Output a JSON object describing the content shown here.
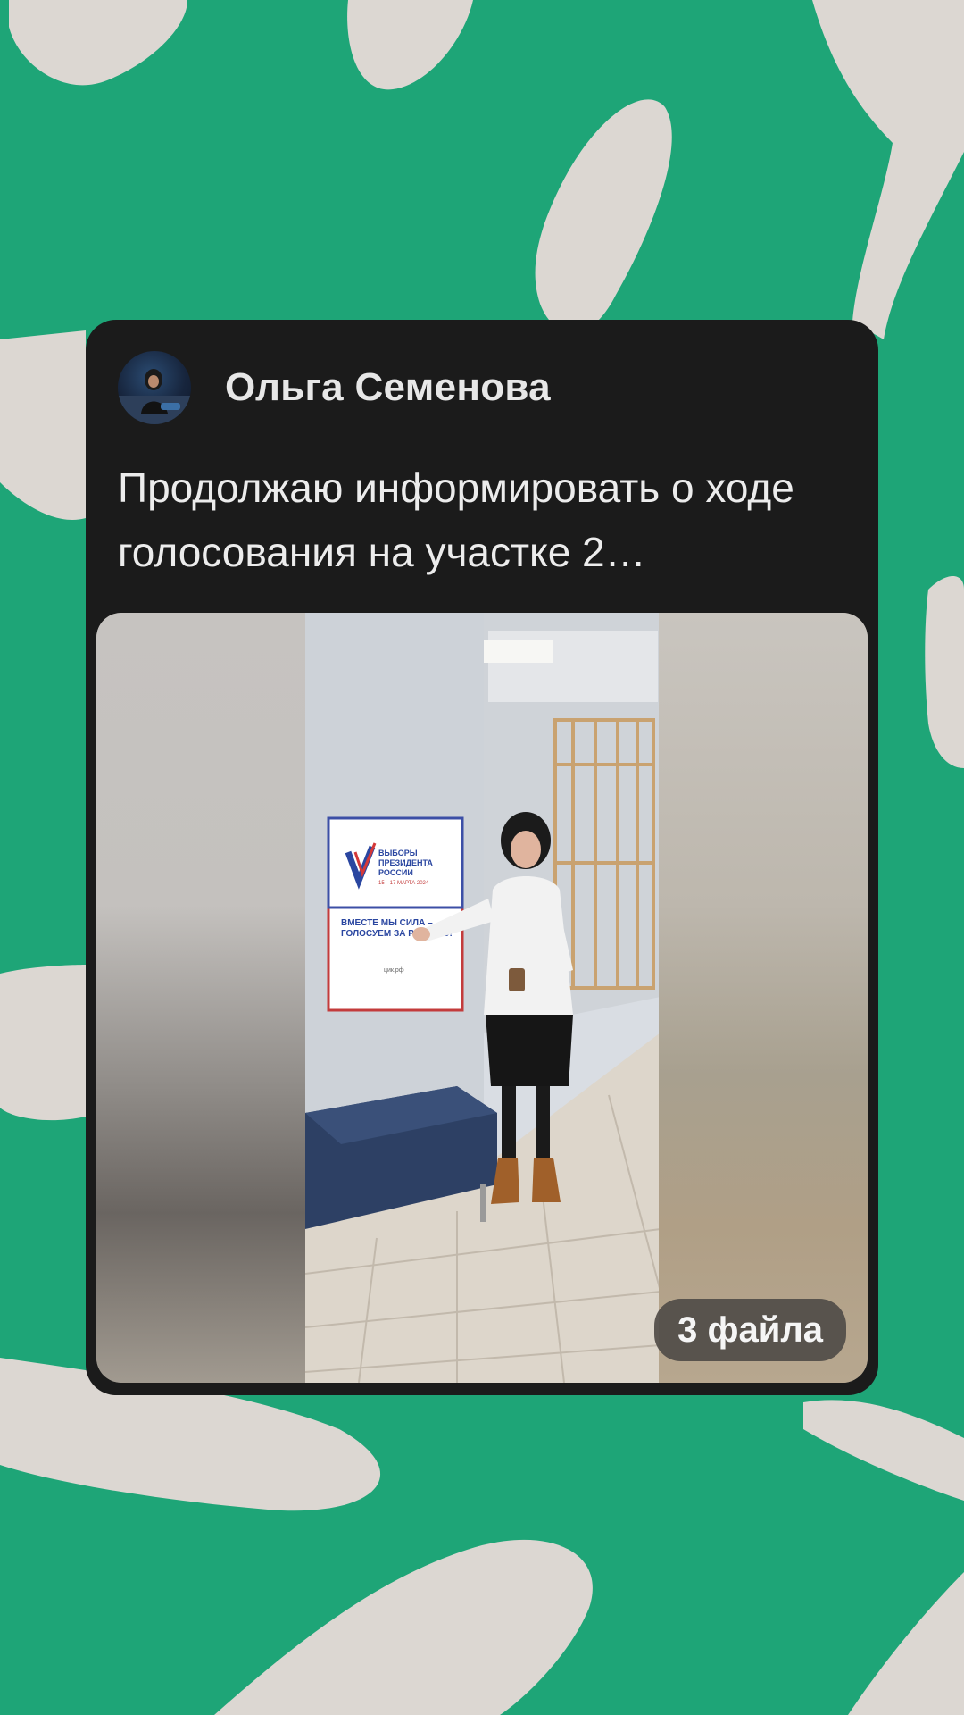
{
  "post": {
    "author_name": "Ольга Семенова",
    "text": "Продолжаю информировать о ходе голосования на участке 2…",
    "files_badge": "3 файла",
    "avatar_icon": "user-avatar"
  },
  "media": {
    "icon": "photo-thumbnail",
    "poster_lines": [
      "ВЫБОРЫ",
      "ПРЕЗИДЕНТА",
      "РОССИИ",
      "15—17 МАРТА 2024",
      "ВМЕСТЕ МЫ СИЛА –",
      "ГОЛОСУЕМ ЗА РОССИЮ!",
      "цик.рф"
    ]
  },
  "colors": {
    "background": "#1ea577",
    "blob": "#dcd7d2",
    "card": "#1b1b1b",
    "text": "#ececec"
  }
}
